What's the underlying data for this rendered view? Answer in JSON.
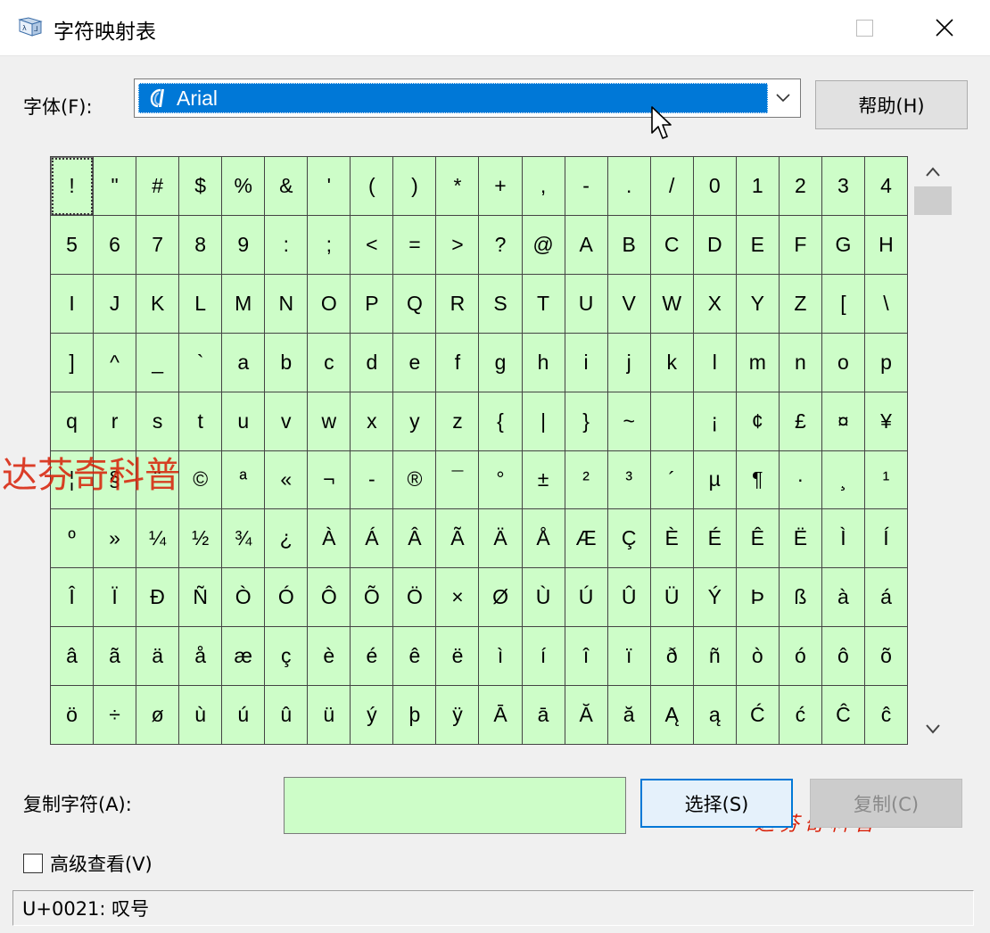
{
  "window": {
    "title": "字符映射表",
    "app_icon": "char-map-icon",
    "controls": [
      "maximize-icon",
      "close-icon"
    ]
  },
  "font": {
    "label": "字体(F):",
    "selected": "Arial",
    "icon": "opentype-font-icon"
  },
  "help_label": "帮助(H)",
  "characters": [
    "!",
    "\"",
    "#",
    "$",
    "%",
    "&",
    "'",
    "(",
    ")",
    "*",
    "+",
    ",",
    "-",
    ".",
    "/",
    "0",
    "1",
    "2",
    "3",
    "4",
    "5",
    "6",
    "7",
    "8",
    "9",
    ":",
    ";",
    "<",
    "=",
    ">",
    "?",
    "@",
    "A",
    "B",
    "C",
    "D",
    "E",
    "F",
    "G",
    "H",
    "I",
    "J",
    "K",
    "L",
    "M",
    "N",
    "O",
    "P",
    "Q",
    "R",
    "S",
    "T",
    "U",
    "V",
    "W",
    "X",
    "Y",
    "Z",
    "[",
    "\\",
    "]",
    "^",
    "_",
    "`",
    "a",
    "b",
    "c",
    "d",
    "e",
    "f",
    "g",
    "h",
    "i",
    "j",
    "k",
    "l",
    "m",
    "n",
    "o",
    "p",
    "q",
    "r",
    "s",
    "t",
    "u",
    "v",
    "w",
    "x",
    "y",
    "z",
    "{",
    "|",
    "}",
    "~",
    " ",
    "¡",
    "¢",
    "£",
    "¤",
    "¥",
    "¦",
    "§",
    "¨",
    "©",
    "ª",
    "«",
    "¬",
    "-",
    "®",
    "¯",
    "°",
    "±",
    "²",
    "³",
    "´",
    "µ",
    "¶",
    "·",
    "¸",
    "¹",
    "º",
    "»",
    "¼",
    "½",
    "¾",
    "¿",
    "À",
    "Á",
    "Â",
    "Ã",
    "Ä",
    "Å",
    "Æ",
    "Ç",
    "È",
    "É",
    "Ê",
    "Ë",
    "Ì",
    "Í",
    "Î",
    "Ï",
    "Ð",
    "Ñ",
    "Ò",
    "Ó",
    "Ô",
    "Õ",
    "Ö",
    "×",
    "Ø",
    "Ù",
    "Ú",
    "Û",
    "Ü",
    "Ý",
    "Þ",
    "ß",
    "à",
    "á",
    "â",
    "ã",
    "ä",
    "å",
    "æ",
    "ç",
    "è",
    "é",
    "ê",
    "ë",
    "ì",
    "í",
    "î",
    "ï",
    "ð",
    "ñ",
    "ò",
    "ó",
    "ô",
    "õ",
    "ö",
    "÷",
    "ø",
    "ù",
    "ú",
    "û",
    "ü",
    "ý",
    "þ",
    "ÿ",
    "Ā",
    "ā",
    "Ă",
    "ă",
    "Ą",
    "ą",
    "Ć",
    "ć",
    "Ĉ",
    "ĉ"
  ],
  "selected_index": 0,
  "scrollbar": {
    "up_icon": "chevron-up-icon",
    "down_icon": "chevron-down-icon",
    "position": 0.0
  },
  "copy": {
    "label": "复制字符(A):",
    "value": "",
    "select_label": "选择(S)",
    "copy_label": "复制(C)"
  },
  "advanced": {
    "label": "高级查看(V)",
    "checked": false
  },
  "status": "U+0021: 叹号",
  "watermark": {
    "text": "达芬奇科普",
    "text2": "达芬奇科普"
  },
  "colors": {
    "grid_bg": "#cdfdc8",
    "accent": "#0078d7",
    "watermark": "#d81e06"
  }
}
